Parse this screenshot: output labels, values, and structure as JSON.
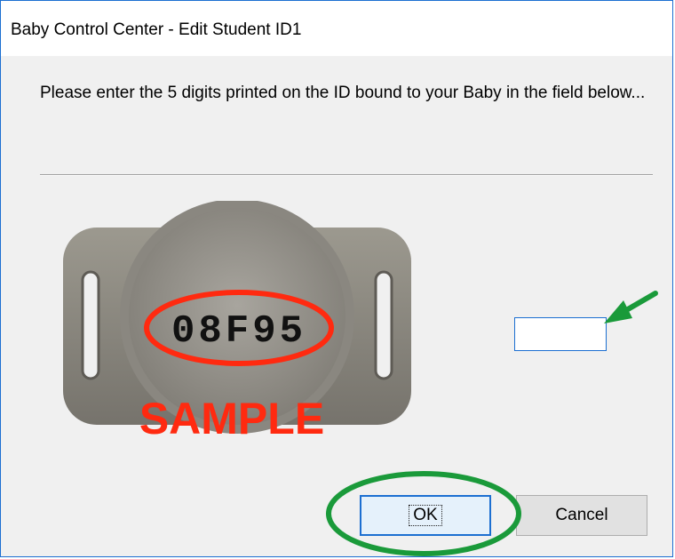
{
  "window": {
    "title": "Baby Control Center - Edit Student ID1"
  },
  "dialog": {
    "message": "Please enter the 5 digits printed on the ID bound to your Baby in the field below..."
  },
  "id_image": {
    "code": "08F95",
    "watermark": "SAMPLE"
  },
  "input": {
    "value": "",
    "placeholder": ""
  },
  "buttons": {
    "ok_label": "OK",
    "cancel_label": "Cancel"
  },
  "annotations": {
    "arrow_color": "#1a9a3a",
    "highlight_color": "#1a9a3a"
  }
}
